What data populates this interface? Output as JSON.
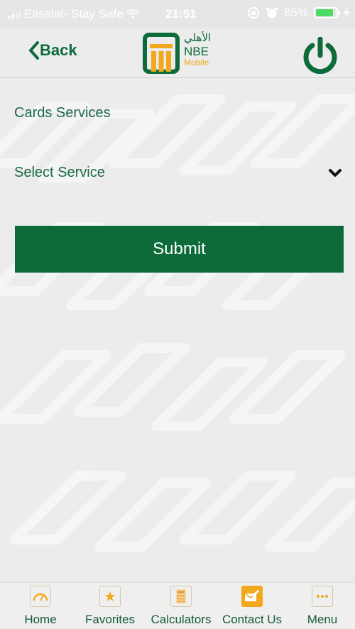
{
  "status_bar": {
    "carrier": "Etisalat- Stay Safe",
    "time": "21:51",
    "battery_percent": "85%",
    "battery_level": 0.85
  },
  "nav": {
    "back_label": "Back",
    "logo_arabic": "الأهلي",
    "logo_nbe": "NBE",
    "logo_mobile": "Mobile"
  },
  "form": {
    "title": "Cards Services",
    "select_placeholder": "Select Service",
    "submit_label": "Submit"
  },
  "tabs": [
    {
      "label": "Home",
      "icon": "speedometer-icon"
    },
    {
      "label": "Favorites",
      "icon": "star-icon"
    },
    {
      "label": "Calculators",
      "icon": "calculator-icon"
    },
    {
      "label": "Contact Us",
      "icon": "envelope-pencil-icon"
    },
    {
      "label": "Menu",
      "icon": "more-dots-icon"
    }
  ],
  "colors": {
    "brand_green": "#0d6b3a",
    "brand_orange": "#f2a81d",
    "background": "#ececec"
  }
}
